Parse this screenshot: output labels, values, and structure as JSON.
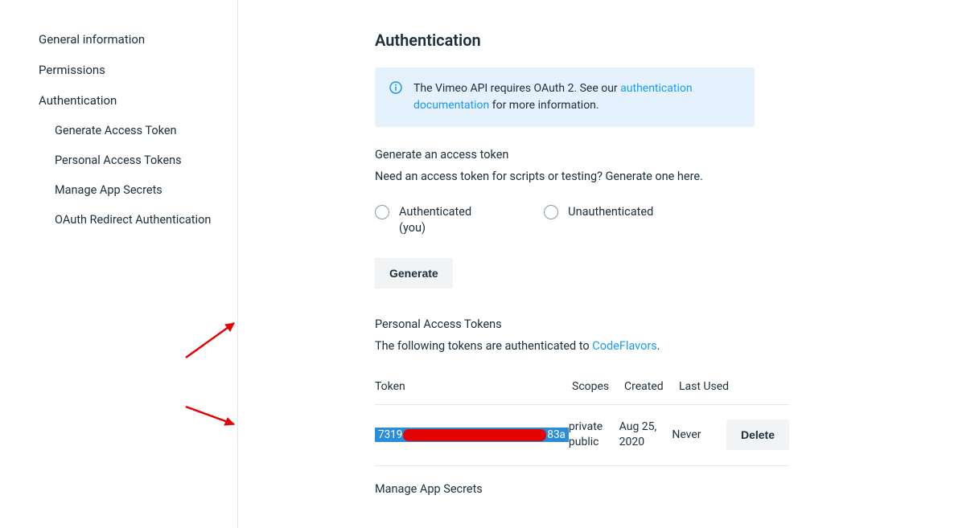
{
  "sidebar": {
    "items": [
      {
        "label": "General information"
      },
      {
        "label": "Permissions"
      },
      {
        "label": "Authentication"
      },
      {
        "label": "Generate Access Token"
      },
      {
        "label": "Personal Access Tokens"
      },
      {
        "label": "Manage App Secrets"
      },
      {
        "label": "OAuth Redirect Authentication"
      }
    ]
  },
  "main": {
    "title": "Authentication",
    "info_prefix": "The Vimeo API requires OAuth 2. See our ",
    "info_link": "authentication documentation",
    "info_suffix": " for more information.",
    "gen_title": "Generate an access token",
    "gen_desc": "Need an access token for scripts or testing? Generate one here.",
    "radio1_line1": "Authenticated",
    "radio1_line2": "(you)",
    "radio2": "Unauthenticated",
    "generate_btn": "Generate",
    "pat_title": "Personal Access Tokens",
    "pat_desc_prefix": "The following tokens are authenticated to ",
    "pat_desc_link": "CodeFlavors",
    "pat_desc_suffix": ".",
    "table": {
      "headers": {
        "token": "Token",
        "scopes": "Scopes",
        "created": "Created",
        "last_used": "Last Used"
      },
      "rows": [
        {
          "token_prefix": "7319",
          "token_suffix": "83a",
          "scopes_line1": "private",
          "scopes_line2": "public",
          "created_line1": "Aug 25,",
          "created_line2": "2020",
          "last_used": "Never",
          "action": "Delete"
        }
      ]
    },
    "manage_secrets": "Manage App Secrets"
  }
}
